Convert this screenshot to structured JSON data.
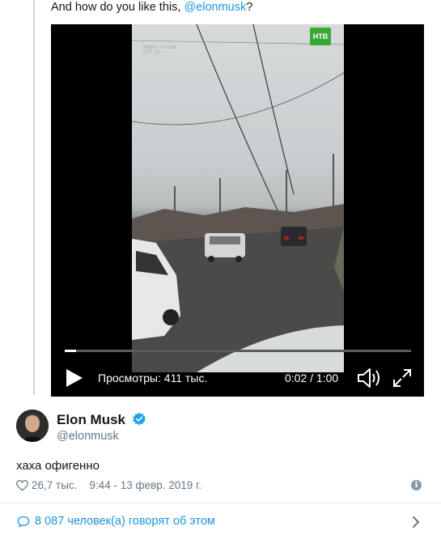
{
  "quote": {
    "text_before": "And how do you like this, ",
    "mention": "@elonmusk",
    "text_after": "?"
  },
  "video": {
    "channel_logo": "НТВ",
    "watermark_line1": "ВИДЕО: VK.COM",
    "watermark_line2": "CITY_24",
    "views_label": "Просмотры: 411 тыс.",
    "time_label": "0:02 / 1:00",
    "progress": 0.033,
    "icons": [
      "play-icon",
      "volume-icon",
      "fullscreen-icon"
    ]
  },
  "author": {
    "name": "Elon Musk",
    "handle": "@elonmusk",
    "verified": true
  },
  "tweet": {
    "text": "хаха офигенно",
    "likes": "26,7 тыс.",
    "timestamp": "9:44 - 13 февр. 2019 г."
  },
  "footer": {
    "replies_label": "8 087 человек(а) говорят об этом"
  },
  "colors": {
    "link": "#1b95e0",
    "muted": "#657786",
    "verified": "#1da1f2"
  }
}
